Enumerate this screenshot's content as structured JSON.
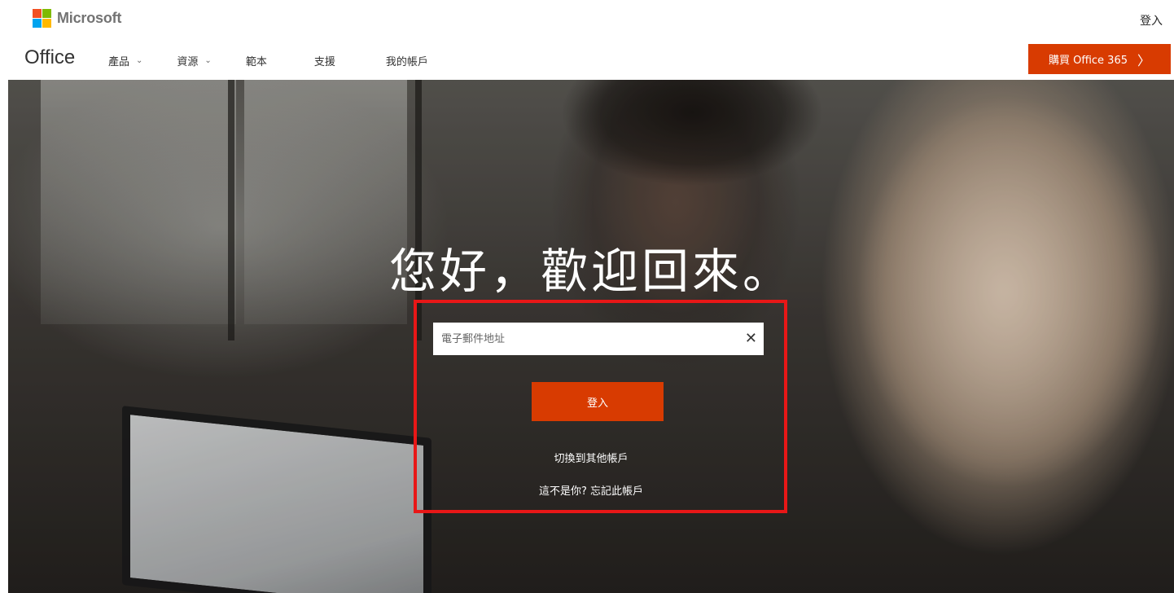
{
  "header": {
    "brand": "Microsoft",
    "sign_in": "登入"
  },
  "nav": {
    "product": "Office",
    "items": [
      {
        "label": "產品",
        "has_dropdown": true
      },
      {
        "label": "資源",
        "has_dropdown": true
      },
      {
        "label": "範本",
        "has_dropdown": false
      },
      {
        "label": "支援",
        "has_dropdown": false
      },
      {
        "label": "我的帳戶",
        "has_dropdown": false
      }
    ],
    "buy_button": "購買 Office 365"
  },
  "hero": {
    "headline": "您好，歡迎回來。",
    "email": {
      "placeholder": "電子郵件地址",
      "value": ""
    },
    "sign_in_button": "登入",
    "switch_account": "切換到其他帳戶",
    "forget_account": "這不是你? 忘記此帳戶"
  },
  "colors": {
    "accent": "#d83b01",
    "highlight": "#e81717"
  },
  "icons": {
    "dropdown": "chevron-down-icon",
    "buy_arrow": "chevron-right-icon",
    "clear": "close-icon"
  }
}
